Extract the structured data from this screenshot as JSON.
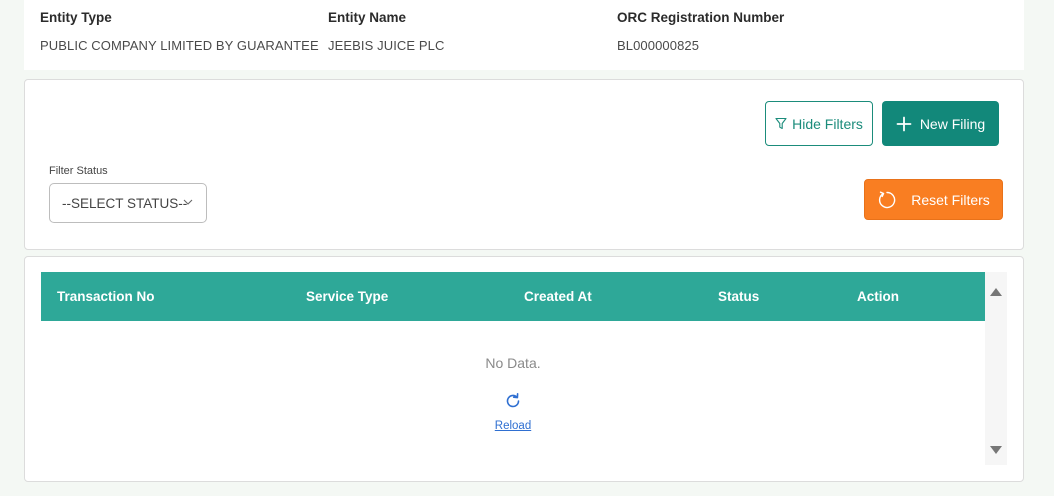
{
  "entity": {
    "type_label": "Entity Type",
    "type_value": "PUBLIC COMPANY LIMITED BY GUARANTEE",
    "name_label": "Entity Name",
    "name_value": "JEEBIS JUICE PLC",
    "orc_label": "ORC Registration Number",
    "orc_value": "BL000000825"
  },
  "filters": {
    "hide_filters_label": "Hide Filters",
    "new_filing_label": "New Filing",
    "filter_status_label": "Filter Status",
    "status_selected": "--SELECT STATUS--",
    "reset_filters_label": "Reset Filters"
  },
  "table": {
    "columns": [
      "Transaction No",
      "Service Type",
      "Created At",
      "Status",
      "Action"
    ],
    "empty_text": "No Data.",
    "reload_label": "Reload"
  },
  "colors": {
    "teal_primary": "#12887a",
    "teal_header": "#2ea898",
    "orange": "#f97e22",
    "link_blue": "#2f6fd1"
  },
  "icons": {
    "hide_filters": "funnel-icon",
    "new_filing": "plus-icon",
    "reset": "refresh-icon",
    "select": "chevron-down-icon",
    "reload": "reload-icon",
    "scroll_up": "scroll-up-arrow-icon",
    "scroll_down": "scroll-down-arrow-icon"
  }
}
